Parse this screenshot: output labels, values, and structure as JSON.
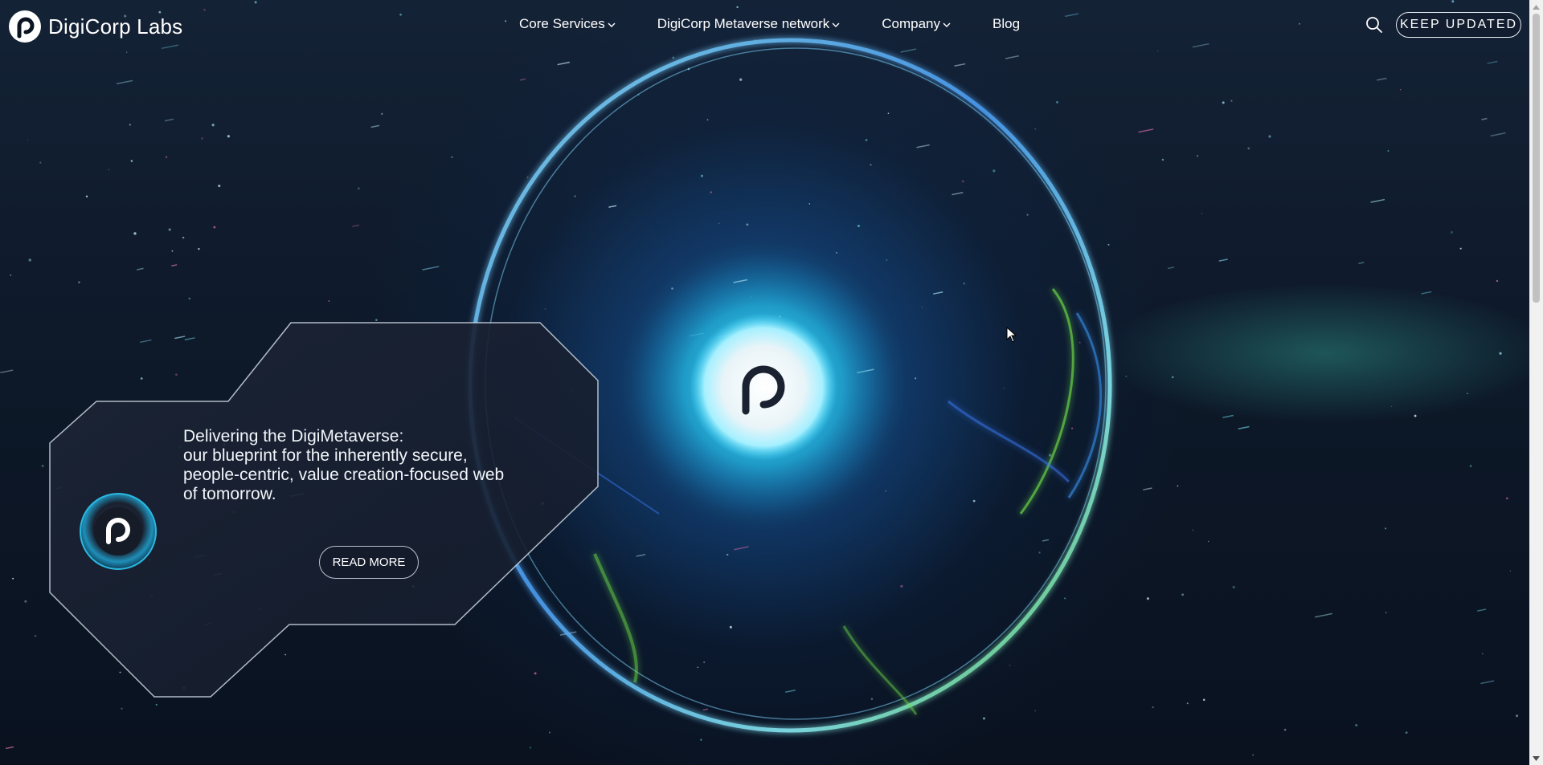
{
  "header": {
    "brand": "DigiCorp Labs",
    "nav": [
      {
        "label": "Core Services",
        "has_dropdown": true
      },
      {
        "label": "DigiCorp Metaverse network",
        "has_dropdown": true
      },
      {
        "label": "Company",
        "has_dropdown": true
      },
      {
        "label": "Blog",
        "has_dropdown": false
      }
    ],
    "search_icon": "search-icon",
    "cta_label": "KEEP UPDATED"
  },
  "hero": {
    "center_logo_icon": "digicorp-logo-icon",
    "card": {
      "lines": [
        "Delivering the DigiMetaverse:",
        "our blueprint for the inherently secure,",
        "people-centric, value creation-focused web",
        "of tomorrow."
      ],
      "badge_icon": "digicorp-badge-icon",
      "button_label": "READ MORE"
    }
  },
  "colors": {
    "background": "#0b1422",
    "accent_cyan": "#2fd6ff",
    "accent_green": "#6fe04a",
    "text": "#ffffff"
  }
}
